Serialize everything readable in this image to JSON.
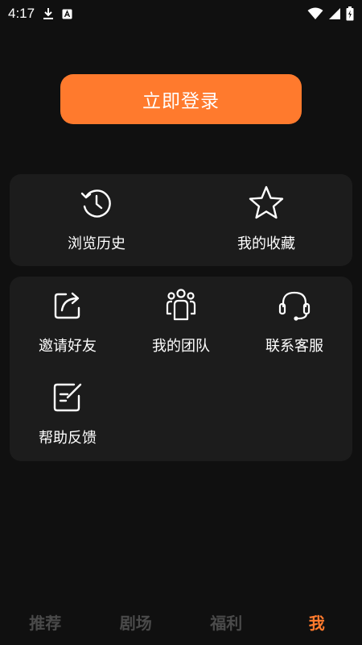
{
  "status_bar": {
    "time": "4:17",
    "icons": [
      "download-icon",
      "keyboard-a-icon",
      "wifi-icon",
      "signal-icon",
      "battery-icon"
    ]
  },
  "login": {
    "label": "立即登录"
  },
  "quick_actions": [
    {
      "label": "浏览历史",
      "icon": "history-icon"
    },
    {
      "label": "我的收藏",
      "icon": "star-icon"
    }
  ],
  "services": [
    {
      "label": "邀请好友",
      "icon": "share-icon"
    },
    {
      "label": "我的团队",
      "icon": "team-icon"
    },
    {
      "label": "联系客服",
      "icon": "headset-icon"
    },
    {
      "label": "帮助反馈",
      "icon": "feedback-icon"
    }
  ],
  "bottom_nav": [
    {
      "label": "推荐",
      "active": false
    },
    {
      "label": "剧场",
      "active": false
    },
    {
      "label": "福利",
      "active": false
    },
    {
      "label": "我",
      "active": true
    }
  ],
  "colors": {
    "accent": "#ff7a2d",
    "background": "#101010",
    "card": "#1c1c1c",
    "inactive_nav": "#4a4a4a"
  }
}
